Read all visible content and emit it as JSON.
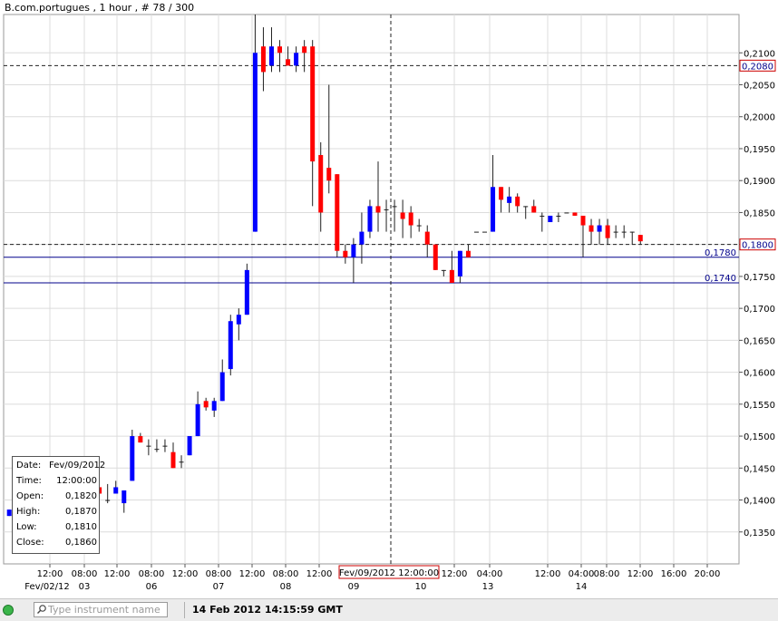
{
  "header": {
    "title": "B.com.portugues , 1 hour , # 78 / 300"
  },
  "colors": {
    "bull": "#0000ff",
    "bear": "#ff0000",
    "grid": "#dcdcdc",
    "dashed": "#202020",
    "support": "#00008b"
  },
  "chart_data": {
    "type": "candlestick",
    "title": "B.com.portugues , 1 hour , # 78 / 300",
    "ylim": [
      0.13,
      0.216
    ],
    "y_ticks": [
      "0,1350",
      "0,1400",
      "0,1450",
      "0,1500",
      "0,1550",
      "0,1600",
      "0,1650",
      "0,1700",
      "0,1750",
      "0,1800",
      "0,1850",
      "0,1900",
      "0,1950",
      "0,2000",
      "0,2050",
      "0,2100"
    ],
    "x_time_labels": [
      "12:00",
      "08:00",
      "12:00",
      "08:00",
      "12:00",
      "08:00",
      "12:00",
      "08:00",
      "12:00",
      "12:00",
      "04:00",
      "12:00",
      "04:00",
      "08:00",
      "12:00",
      "16:00",
      "20:00"
    ],
    "x_date_labels": [
      "Fev/02/12",
      "03",
      "06",
      "07",
      "08",
      "09",
      "10",
      "13",
      "14"
    ],
    "crosshair_label": "Fev/09/2012 12:00:00",
    "price_markers": [
      {
        "value": 0.208,
        "label": "0,2080",
        "style": "dashed",
        "boxed": true
      },
      {
        "value": 0.18,
        "label": "0,1800",
        "style": "dashed",
        "boxed": true
      },
      {
        "value": 0.178,
        "label": "0,1780",
        "style": "solid",
        "boxed": false
      },
      {
        "value": 0.174,
        "label": "0,1740",
        "style": "solid",
        "boxed": false
      }
    ],
    "candles": [
      {
        "o": 0.1375,
        "h": 0.1385,
        "l": 0.1375,
        "c": 0.1385
      },
      {
        "o": 0.141,
        "h": 0.142,
        "l": 0.14,
        "c": 0.141
      },
      {
        "o": 0.142,
        "h": 0.142,
        "l": 0.14,
        "c": 0.14
      },
      {
        "o": 0.141,
        "h": 0.142,
        "l": 0.14,
        "c": 0.141
      },
      {
        "o": 0.14,
        "h": 0.142,
        "l": 0.14,
        "c": 0.141
      },
      {
        "o": 0.1395,
        "h": 0.141,
        "l": 0.1395,
        "c": 0.14
      },
      {
        "o": 0.1405,
        "h": 0.1405,
        "l": 0.1395,
        "c": 0.1405
      },
      {
        "o": 0.1395,
        "h": 0.1405,
        "l": 0.1385,
        "c": 0.1405
      },
      {
        "o": 0.1405,
        "h": 0.142,
        "l": 0.14,
        "c": 0.142
      },
      {
        "o": 0.1405,
        "h": 0.1425,
        "l": 0.14,
        "c": 0.1405
      },
      {
        "o": 0.141,
        "h": 0.142,
        "l": 0.1405,
        "c": 0.1415
      },
      {
        "o": 0.142,
        "h": 0.142,
        "l": 0.141,
        "c": 0.141
      },
      {
        "o": 0.14,
        "h": 0.1425,
        "l": 0.1395,
        "c": 0.14
      },
      {
        "o": 0.141,
        "h": 0.143,
        "l": 0.141,
        "c": 0.142
      },
      {
        "o": 0.1395,
        "h": 0.1415,
        "l": 0.138,
        "c": 0.1415
      },
      {
        "o": 0.143,
        "h": 0.151,
        "l": 0.143,
        "c": 0.15
      },
      {
        "o": 0.15,
        "h": 0.1505,
        "l": 0.149,
        "c": 0.149
      },
      {
        "o": 0.1485,
        "h": 0.1495,
        "l": 0.147,
        "c": 0.1485
      },
      {
        "o": 0.148,
        "h": 0.1495,
        "l": 0.1475,
        "c": 0.148
      },
      {
        "o": 0.1485,
        "h": 0.1495,
        "l": 0.1475,
        "c": 0.1485
      },
      {
        "o": 0.1475,
        "h": 0.149,
        "l": 0.145,
        "c": 0.145
      },
      {
        "o": 0.146,
        "h": 0.147,
        "l": 0.145,
        "c": 0.146
      },
      {
        "o": 0.147,
        "h": 0.15,
        "l": 0.147,
        "c": 0.15
      },
      {
        "o": 0.15,
        "h": 0.157,
        "l": 0.15,
        "c": 0.155
      },
      {
        "o": 0.1555,
        "h": 0.156,
        "l": 0.154,
        "c": 0.1545
      },
      {
        "o": 0.154,
        "h": 0.156,
        "l": 0.153,
        "c": 0.1555
      },
      {
        "o": 0.1555,
        "h": 0.162,
        "l": 0.1555,
        "c": 0.16
      },
      {
        "o": 0.1605,
        "h": 0.169,
        "l": 0.1595,
        "c": 0.168
      },
      {
        "o": 0.1675,
        "h": 0.17,
        "l": 0.165,
        "c": 0.169
      },
      {
        "o": 0.169,
        "h": 0.177,
        "l": 0.169,
        "c": 0.176
      },
      {
        "o": 0.182,
        "h": 0.216,
        "l": 0.182,
        "c": 0.21
      },
      {
        "o": 0.211,
        "h": 0.214,
        "l": 0.204,
        "c": 0.207
      },
      {
        "o": 0.208,
        "h": 0.214,
        "l": 0.207,
        "c": 0.211
      },
      {
        "o": 0.211,
        "h": 0.212,
        "l": 0.207,
        "c": 0.21
      },
      {
        "o": 0.209,
        "h": 0.211,
        "l": 0.208,
        "c": 0.208
      },
      {
        "o": 0.208,
        "h": 0.211,
        "l": 0.207,
        "c": 0.21
      },
      {
        "o": 0.211,
        "h": 0.212,
        "l": 0.207,
        "c": 0.21
      },
      {
        "o": 0.211,
        "h": 0.212,
        "l": 0.186,
        "c": 0.193
      },
      {
        "o": 0.194,
        "h": 0.196,
        "l": 0.182,
        "c": 0.185
      },
      {
        "o": 0.192,
        "h": 0.205,
        "l": 0.188,
        "c": 0.19
      },
      {
        "o": 0.191,
        "h": 0.191,
        "l": 0.178,
        "c": 0.179
      },
      {
        "o": 0.179,
        "h": 0.18,
        "l": 0.177,
        "c": 0.178
      },
      {
        "o": 0.178,
        "h": 0.181,
        "l": 0.174,
        "c": 0.18
      },
      {
        "o": 0.18,
        "h": 0.185,
        "l": 0.177,
        "c": 0.182
      },
      {
        "o": 0.182,
        "h": 0.187,
        "l": 0.181,
        "c": 0.186
      },
      {
        "o": 0.186,
        "h": 0.193,
        "l": 0.182,
        "c": 0.185
      },
      {
        "o": 0.1855,
        "h": 0.187,
        "l": 0.182,
        "c": 0.1855
      },
      {
        "o": 0.186,
        "h": 0.187,
        "l": 0.182,
        "c": 0.186
      },
      {
        "o": 0.185,
        "h": 0.187,
        "l": 0.181,
        "c": 0.184
      },
      {
        "o": 0.185,
        "h": 0.186,
        "l": 0.181,
        "c": 0.183
      },
      {
        "o": 0.183,
        "h": 0.184,
        "l": 0.182,
        "c": 0.183
      },
      {
        "o": 0.182,
        "h": 0.183,
        "l": 0.178,
        "c": 0.18
      },
      {
        "o": 0.18,
        "h": 0.18,
        "l": 0.176,
        "c": 0.176
      },
      {
        "o": 0.176,
        "h": 0.176,
        "l": 0.175,
        "c": 0.176
      },
      {
        "o": 0.176,
        "h": 0.179,
        "l": 0.174,
        "c": 0.174
      },
      {
        "o": 0.175,
        "h": 0.179,
        "l": 0.174,
        "c": 0.179
      },
      {
        "o": 0.179,
        "h": 0.18,
        "l": 0.178,
        "c": 0.178
      },
      {
        "o": 0.182,
        "h": 0.182,
        "l": 0.182,
        "c": 0.182
      },
      {
        "o": 0.182,
        "h": 0.182,
        "l": 0.182,
        "c": 0.182
      },
      {
        "o": 0.182,
        "h": 0.194,
        "l": 0.182,
        "c": 0.189
      },
      {
        "o": 0.189,
        "h": 0.189,
        "l": 0.185,
        "c": 0.187
      },
      {
        "o": 0.1865,
        "h": 0.189,
        "l": 0.185,
        "c": 0.1875
      },
      {
        "o": 0.1875,
        "h": 0.188,
        "l": 0.185,
        "c": 0.186
      },
      {
        "o": 0.186,
        "h": 0.186,
        "l": 0.184,
        "c": 0.186
      },
      {
        "o": 0.186,
        "h": 0.187,
        "l": 0.185,
        "c": 0.185
      },
      {
        "o": 0.1845,
        "h": 0.185,
        "l": 0.182,
        "c": 0.1845
      },
      {
        "o": 0.1835,
        "h": 0.1845,
        "l": 0.1835,
        "c": 0.1845
      },
      {
        "o": 0.1845,
        "h": 0.185,
        "l": 0.1835,
        "c": 0.1845
      },
      {
        "o": 0.185,
        "h": 0.185,
        "l": 0.185,
        "c": 0.185
      },
      {
        "o": 0.185,
        "h": 0.185,
        "l": 0.1845,
        "c": 0.1845
      },
      {
        "o": 0.1845,
        "h": 0.1845,
        "l": 0.178,
        "c": 0.183
      },
      {
        "o": 0.183,
        "h": 0.184,
        "l": 0.18,
        "c": 0.182
      },
      {
        "o": 0.182,
        "h": 0.184,
        "l": 0.18,
        "c": 0.183
      },
      {
        "o": 0.183,
        "h": 0.184,
        "l": 0.18,
        "c": 0.181
      },
      {
        "o": 0.182,
        "h": 0.183,
        "l": 0.181,
        "c": 0.182
      },
      {
        "o": 0.182,
        "h": 0.183,
        "l": 0.181,
        "c": 0.182
      },
      {
        "o": 0.182,
        "h": 0.182,
        "l": 0.18,
        "c": 0.182
      },
      {
        "o": 0.1815,
        "h": 0.1815,
        "l": 0.18,
        "c": 0.1805
      }
    ]
  },
  "info_box": {
    "date_label": "Date:",
    "date_value": "Fev/09/2012",
    "time_label": "Time:",
    "time_value": "12:00:00",
    "open_label": "Open:",
    "open_value": "0,1820",
    "high_label": "High:",
    "high_value": "0,1870",
    "low_label": "Low:",
    "low_value": "0,1810",
    "close_label": "Close:",
    "close_value": "0,1860"
  },
  "footer": {
    "search_placeholder": "Type instrument name",
    "clock": "14 Feb 2012 14:15:59 GMT"
  }
}
